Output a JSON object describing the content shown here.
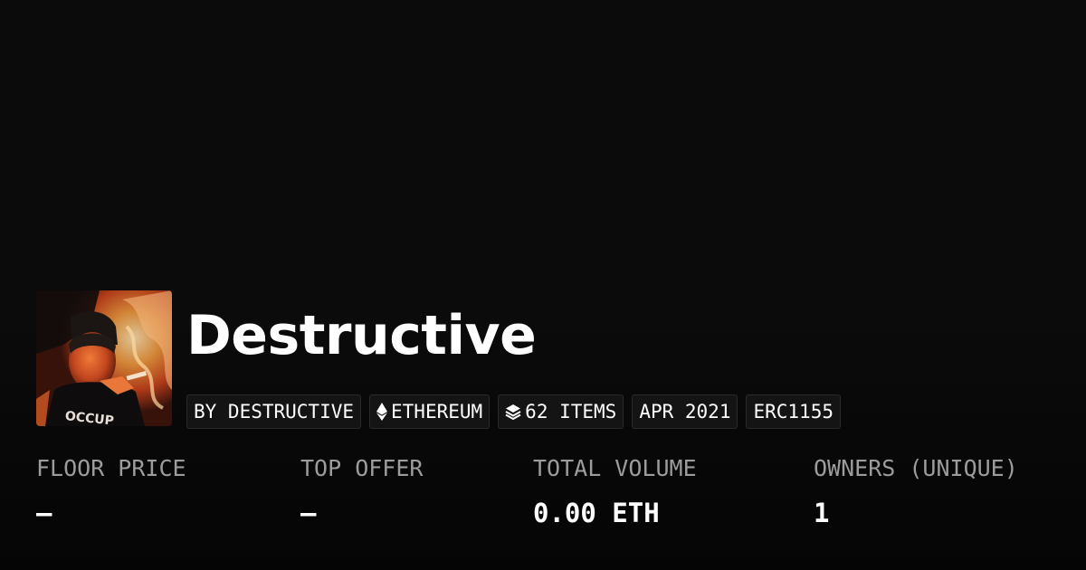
{
  "collection": {
    "name": "Destructive",
    "chips": {
      "creator": "BY DESTRUCTIVE",
      "chain": "ETHEREUM",
      "items": "62 ITEMS",
      "date": "APR 2021",
      "standard": "ERC1155"
    }
  },
  "stats": [
    {
      "label": "FLOOR PRICE",
      "value": "–"
    },
    {
      "label": "TOP OFFER",
      "value": "–"
    },
    {
      "label": "TOTAL VOLUME",
      "value": "0.00 ETH"
    },
    {
      "label": "OWNERS (UNIQUE)",
      "value": "1"
    }
  ],
  "icons": {
    "chain": "ethereum-icon",
    "items": "layers-icon"
  },
  "colors": {
    "background": "#0b0b0b",
    "text": "#ffffff",
    "muted": "#9c9c9c",
    "chip_bg": "#141414",
    "chip_border": "#2a2a2a",
    "flame": "#e9601f"
  }
}
